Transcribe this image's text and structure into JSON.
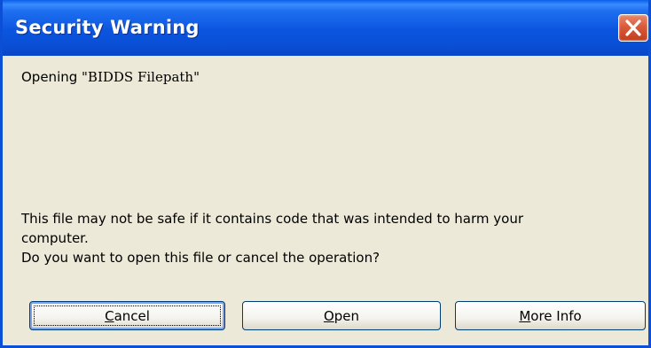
{
  "dialog": {
    "title": "Security Warning",
    "open_prefix": "Opening ",
    "file_name": "\"BIDDS Filepath\"",
    "warning_line1": "This file may not be safe if it contains code that was intended to harm your",
    "warning_line2": "computer.",
    "question": "Do you want to open this file or cancel the operation?"
  },
  "buttons": {
    "cancel": {
      "mnemonic": "C",
      "rest": "ancel"
    },
    "open": {
      "mnemonic": "O",
      "rest": "pen"
    },
    "more_info": {
      "mnemonic": "M",
      "rest": "ore Info"
    }
  },
  "icons": {
    "close": "close-icon"
  },
  "colors": {
    "titlebar": "#0a4fd6",
    "window_bg": "#ece9d8",
    "close_button": "#db5a3a"
  }
}
